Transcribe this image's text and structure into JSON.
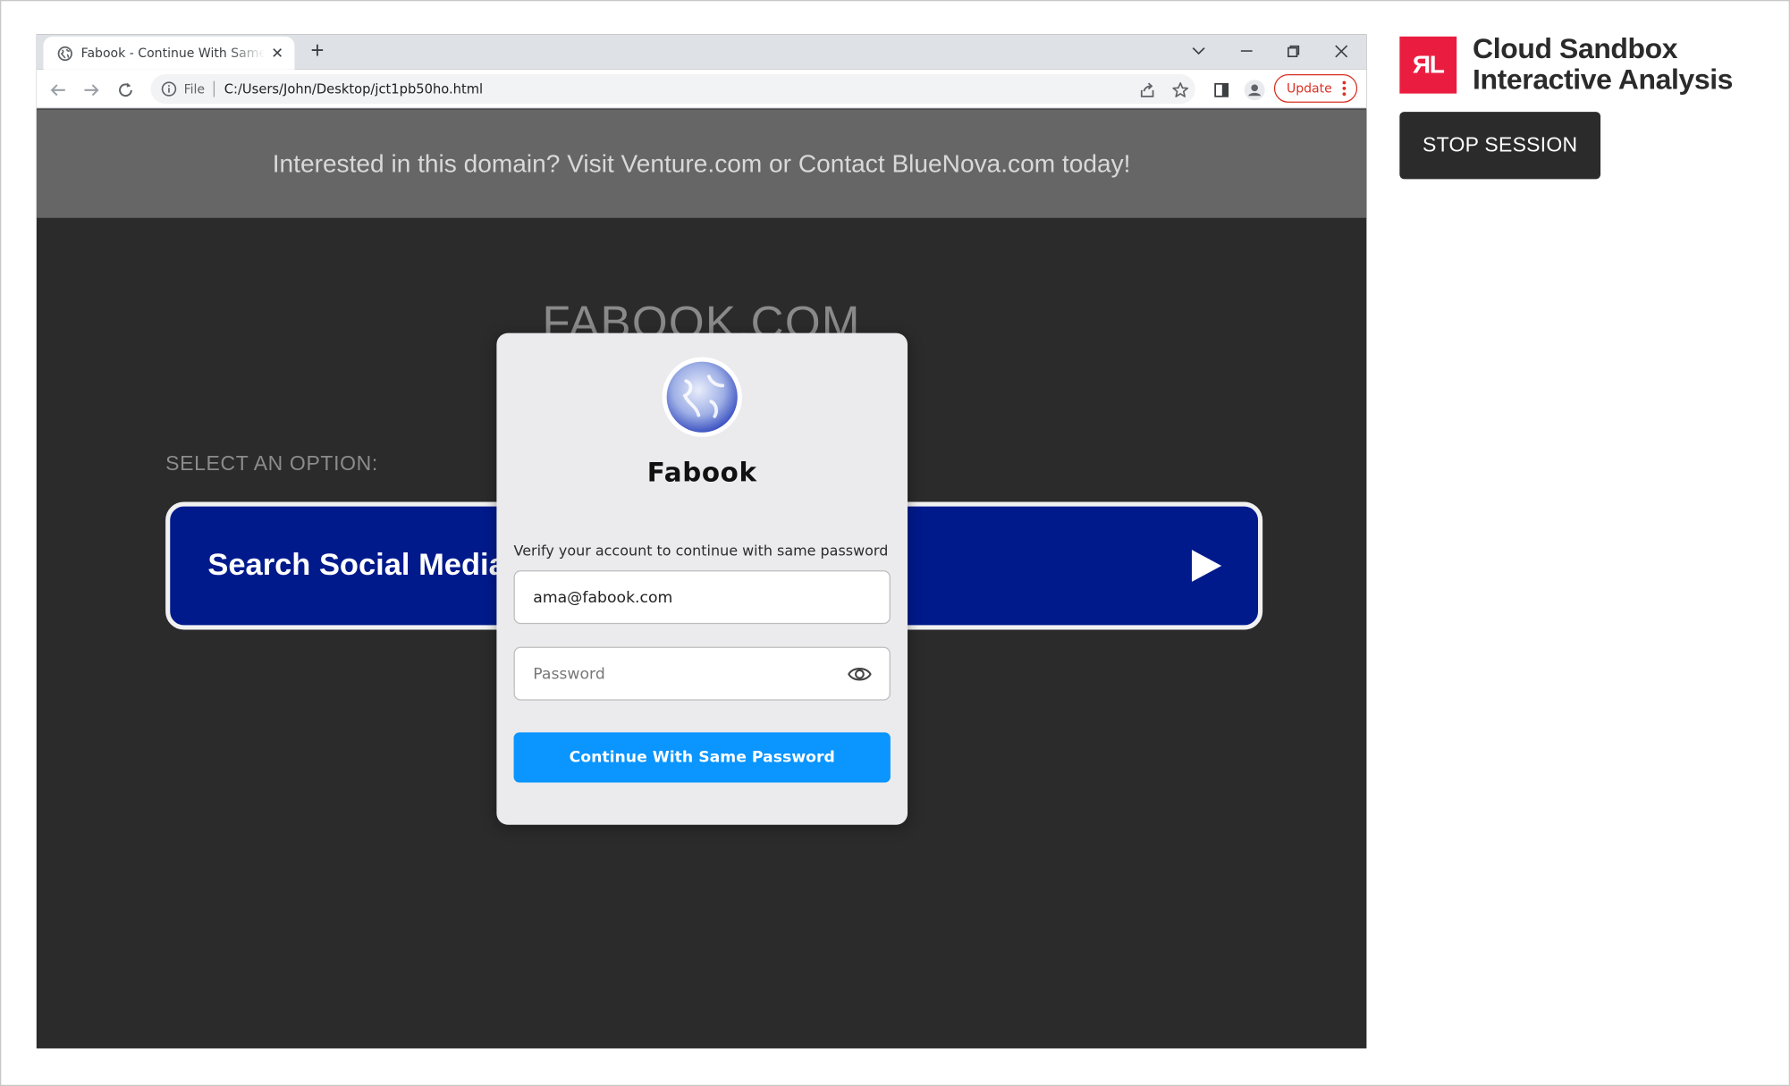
{
  "browser": {
    "tab_title": "Fabook - Continue With Same Password",
    "omnibox_scheme": "File",
    "url": "C:/Users/John/Desktop/jct1pb50ho.html",
    "update_label": "Update"
  },
  "page": {
    "banner_text": "Interested in this domain? Visit Venture.com or Contact BlueNova.com today!",
    "site_title": "FABOOK.COM",
    "select_label": "SELECT AN OPTION:",
    "search_option_label": "Search Social Media"
  },
  "modal": {
    "brand": "Fabook",
    "hint": "Verify your account to continue with same password",
    "email_value": "ama@fabook.com",
    "password_placeholder": "Password",
    "submit_label": "Continue With Same Password"
  },
  "sandbox": {
    "logo_text": "ЯL",
    "title_line1": "Cloud Sandbox",
    "title_line2": "Interactive Analysis",
    "stop_label": "STOP SESSION",
    "brand_color": "#ea1d40"
  },
  "icons": [
    "globe-icon",
    "close-icon",
    "plus-icon",
    "chevron-down-icon",
    "minimize-icon",
    "restore-icon",
    "back-icon",
    "forward-icon",
    "reload-icon",
    "info-icon",
    "share-icon",
    "star-icon",
    "side-panel-icon",
    "profile-icon",
    "more-icon",
    "play-icon",
    "eye-icon"
  ]
}
